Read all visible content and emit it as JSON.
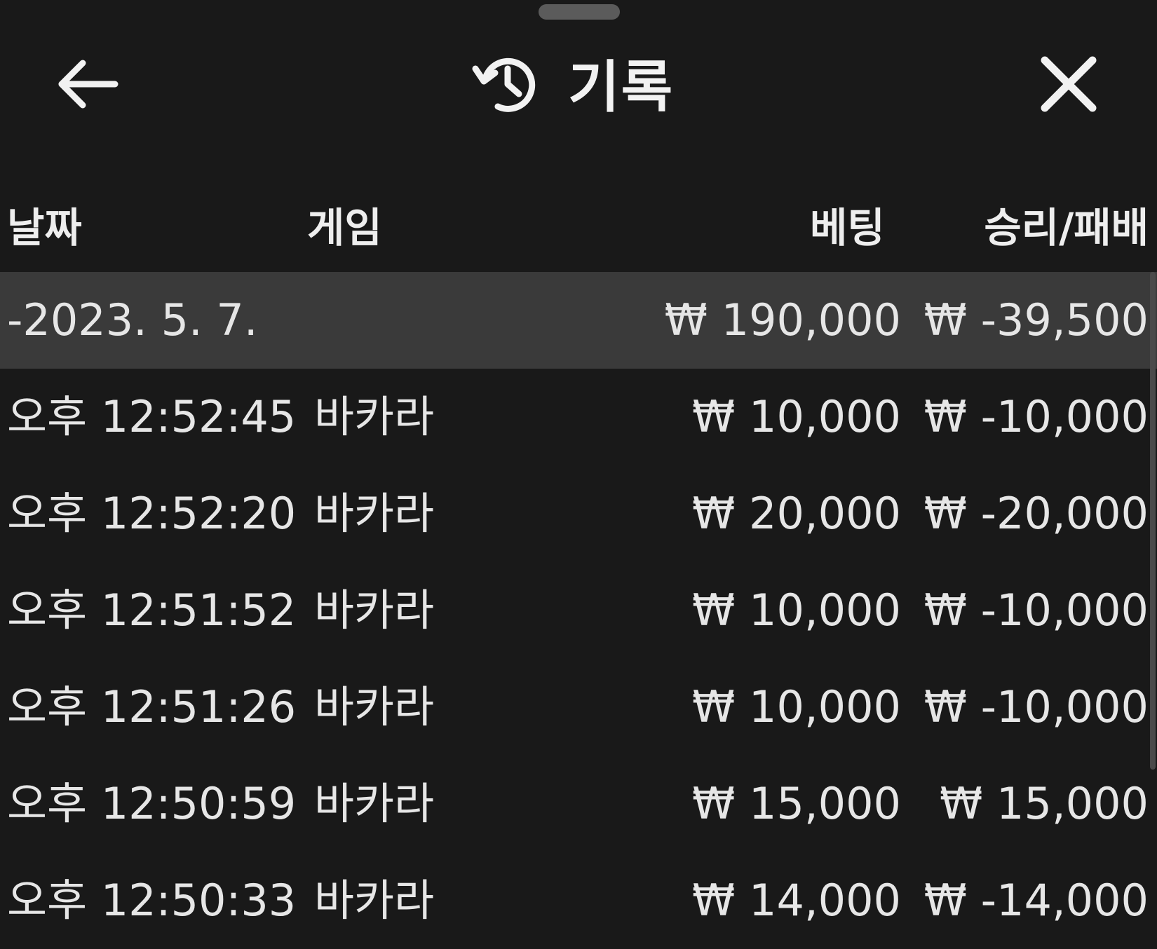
{
  "header": {
    "title": "기록"
  },
  "columns": {
    "date": "날짜",
    "game": "게임",
    "bet": "베팅",
    "result": "승리/패배"
  },
  "summary": {
    "date": "-2023. 5. 7.",
    "bet": "₩ 190,000",
    "result": "₩ -39,500"
  },
  "rows": [
    {
      "time": "오후 12:52:45",
      "game": "바카라",
      "bet": "₩ 10,000",
      "result": "₩ -10,000"
    },
    {
      "time": "오후 12:52:20",
      "game": "바카라",
      "bet": "₩ 20,000",
      "result": "₩ -20,000"
    },
    {
      "time": "오후 12:51:52",
      "game": "바카라",
      "bet": "₩ 10,000",
      "result": "₩ -10,000"
    },
    {
      "time": "오후 12:51:26",
      "game": "바카라",
      "bet": "₩ 10,000",
      "result": "₩ -10,000"
    },
    {
      "time": "오후 12:50:59",
      "game": "바카라",
      "bet": "₩ 15,000",
      "result": "₩ 15,000"
    },
    {
      "time": "오후 12:50:33",
      "game": "바카라",
      "bet": "₩ 14,000",
      "result": "₩ -14,000"
    }
  ],
  "icons": {
    "back": "arrow-left-icon",
    "history": "history-icon",
    "close": "close-icon"
  }
}
